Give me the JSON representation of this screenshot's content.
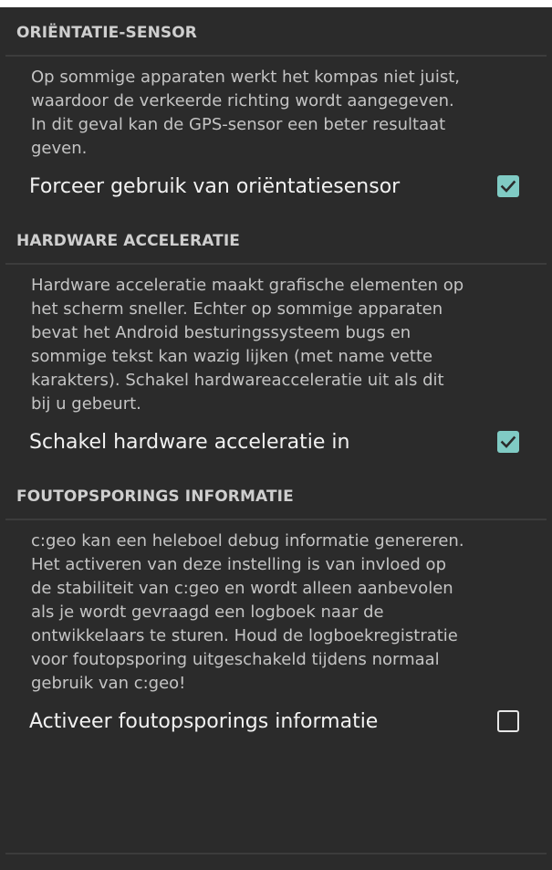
{
  "sections": [
    {
      "header": "ORIËNTATIE-SENSOR",
      "summary_lines": [
        "Op sommige apparaten werkt het kompas niet juist,",
        "waardoor de verkeerde richting wordt aangegeven.",
        "In dit geval kan de GPS-sensor een beter resultaat",
        "geven."
      ],
      "preference_title": "Forceer gebruik van oriëntatiesensor",
      "checked": true
    },
    {
      "header": "HARDWARE ACCELERATIE",
      "summary_lines": [
        "Hardware acceleratie maakt grafische elementen op",
        "het scherm sneller. Echter op sommige apparaten",
        "bevat het Android besturingssysteem bugs en",
        "sommige tekst kan wazig lijken (met name vette",
        "karakters). Schakel hardwareacceleratie uit als dit",
        "bij u gebeurt."
      ],
      "preference_title": "Schakel hardware acceleratie in",
      "checked": true
    },
    {
      "header": "FOUTOPSPORINGS INFORMATIE",
      "summary_lines": [
        "c:geo kan een heleboel debug informatie genereren.",
        "Het activeren van deze instelling is van invloed op",
        "de stabiliteit van c:geo en wordt alleen aanbevolen",
        "als je wordt gevraagd een logboek naar de",
        "ontwikkelaars te sturen. Houd de logboekregistratie",
        "voor foutopsporing uitgeschakeld tijdens normaal",
        "gebruik van c:geo!"
      ],
      "preference_title": "Activeer foutopsporings informatie",
      "checked": false
    }
  ],
  "colors": {
    "accent": "#80cbc4",
    "background": "#2b2b2b",
    "divider": "#3c3c3c"
  },
  "icons": {
    "checked": "checkbox-checked-icon",
    "unchecked": "checkbox-unchecked-icon"
  }
}
